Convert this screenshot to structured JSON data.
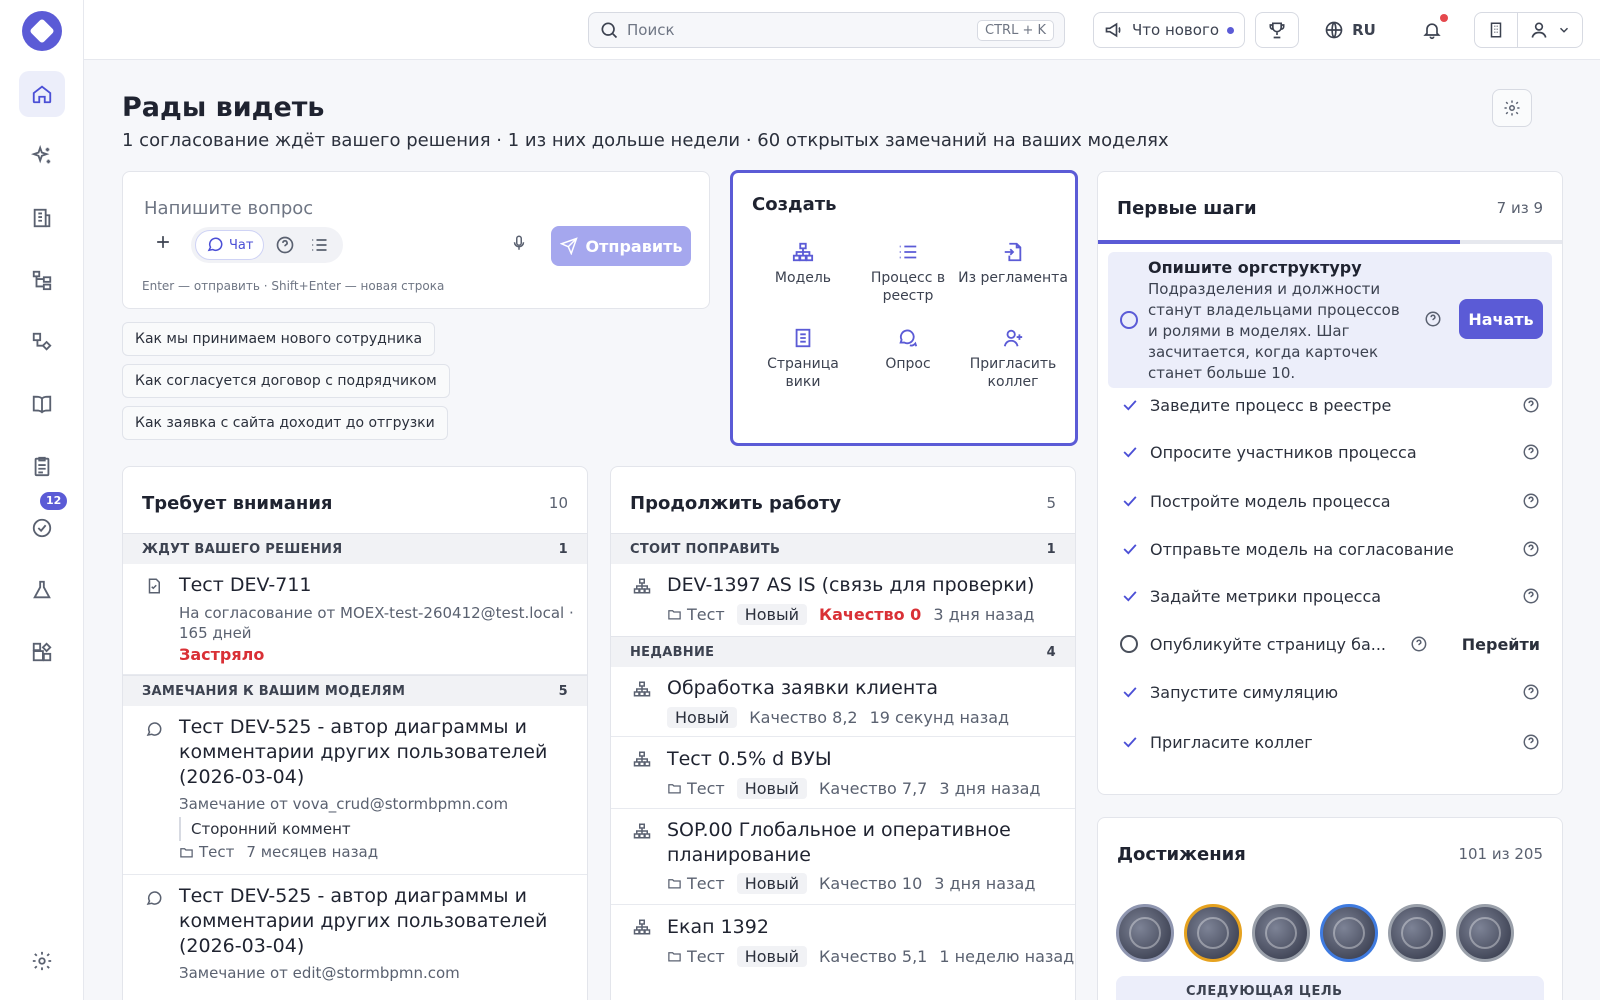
{
  "topbar": {
    "search_placeholder": "Поиск",
    "search_shortcut": "CTRL + K",
    "news_label": "Что нового",
    "language": "RU"
  },
  "sidebar": {
    "items": [
      {
        "name": "home",
        "active": true
      },
      {
        "name": "ai-assistant"
      },
      {
        "name": "organization"
      },
      {
        "name": "process-tree"
      },
      {
        "name": "processes"
      },
      {
        "name": "wiki"
      },
      {
        "name": "tasks"
      },
      {
        "name": "approvals",
        "badge": "12"
      },
      {
        "name": "simulation"
      },
      {
        "name": "apps"
      }
    ]
  },
  "page": {
    "title": "Рады видеть",
    "subtitle": "1 согласование ждёт вашего решения · 1 из них дольше недели · 60 открытых замечаний на ваших моделях"
  },
  "ask": {
    "placeholder": "Напишите вопрос",
    "chat_label": "Чат",
    "send_label": "Отправить",
    "hint": "Enter — отправить · Shift+Enter — новая строка"
  },
  "suggestions": [
    "Как мы принимаем нового сотрудника",
    "Как согласуется договор с подрядчиком",
    "Как заявка с сайта доходит до отгрузки"
  ],
  "create": {
    "title": "Создать",
    "items": [
      {
        "label": "Модель",
        "icon": "model-icon"
      },
      {
        "label": "Процесс в реестр",
        "icon": "list-icon"
      },
      {
        "label": "Из регламента",
        "icon": "file-import-icon"
      },
      {
        "label": "Страница вики",
        "icon": "page-icon"
      },
      {
        "label": "Опрос",
        "icon": "chat-bubbles-icon"
      },
      {
        "label": "Пригласить коллег",
        "icon": "user-plus-icon"
      }
    ]
  },
  "attention": {
    "title": "Требует внимания",
    "count": "10",
    "sections": [
      {
        "label": "ЖДУТ ВАШЕГО РЕШЕНИЯ",
        "count": "1",
        "items": [
          {
            "title": "Тест DEV-711",
            "sub": "На согласование от MOEX-test-260412@test.local · 165 дней",
            "status": "Застряло"
          }
        ]
      },
      {
        "label": "ЗАМЕЧАНИЯ К ВАШИМ МОДЕЛЯМ",
        "count": "5",
        "items": [
          {
            "title": "Тест DEV-525 - автор диаграммы и комментарии других пользователей (2026-03-04)",
            "sub": "Замечание от vova_crud@stormbpmn.com",
            "quote": "Сторонний коммент",
            "folder": "Тест",
            "time": "7 месяцев назад"
          },
          {
            "title": "Тест DEV-525 - автор диаграммы и комментарии других пользователей (2026-03-04)",
            "sub": "Замечание от edit@stormbpmn.com"
          }
        ]
      }
    ]
  },
  "continue": {
    "title": "Продолжить работу",
    "count": "5",
    "sections": [
      {
        "label": "СТОИТ ПОПРАВИТЬ",
        "count": "1",
        "items": [
          {
            "title": "DEV-1397 AS IS (связь для проверки)",
            "folder": "Тест",
            "status": "Новый",
            "quality": "Качество 0",
            "time": "3 дня назад"
          }
        ]
      },
      {
        "label": "НЕДАВНИЕ",
        "count": "4",
        "items": [
          {
            "title": "Обработка заявки клиента",
            "status": "Новый",
            "quality": "Качество 8,2",
            "time": "19 секунд назад"
          },
          {
            "title": "Тест 0.5% d ВУЫ",
            "folder": "Тест",
            "status": "Новый",
            "quality": "Качество 7,7",
            "time": "3 дня назад"
          },
          {
            "title": "SOP.00 Глобальное и оперативное планирование",
            "folder": "Тест",
            "status": "Новый",
            "quality": "Качество 10",
            "time": "3 дня назад"
          },
          {
            "title": "Екап 1392",
            "folder": "Тест",
            "status": "Новый",
            "quality": "Качество 5,1",
            "time": "1 неделю назад"
          }
        ]
      }
    ]
  },
  "first_steps": {
    "title": "Первые шаги",
    "count": "7 из 9",
    "progress": 0.78,
    "active": {
      "title": "Опишите оргструктуру",
      "desc": "Подразделения и должности станут владельцами процессов и ролями в моделях. Шаг засчитается, когда карточек станет больше 10.",
      "button": "Начать"
    },
    "steps": [
      {
        "label": "Заведите процесс в реестре",
        "done": true
      },
      {
        "label": "Опросите участников процесса",
        "done": true
      },
      {
        "label": "Постройте модель процесса",
        "done": true
      },
      {
        "label": "Отправьте модель на согласование",
        "done": true
      },
      {
        "label": "Задайте метрики процесса",
        "done": true
      },
      {
        "label": "Опубликуйте страницу ба...",
        "done": false,
        "action": "Перейти"
      },
      {
        "label": "Запустите симуляцию",
        "done": true
      },
      {
        "label": "Пригласите коллег",
        "done": true
      }
    ]
  },
  "achievements": {
    "title": "Достижения",
    "count": "101 из 205",
    "next_goal_label": "СЛЕДУЮЩАЯ ЦЕЛЬ",
    "badge_colors": [
      "#8f96b0",
      "#e6a21f",
      "#9aa0aa",
      "#3f7be0",
      "#9aa0aa",
      "#9aa0aa"
    ]
  }
}
